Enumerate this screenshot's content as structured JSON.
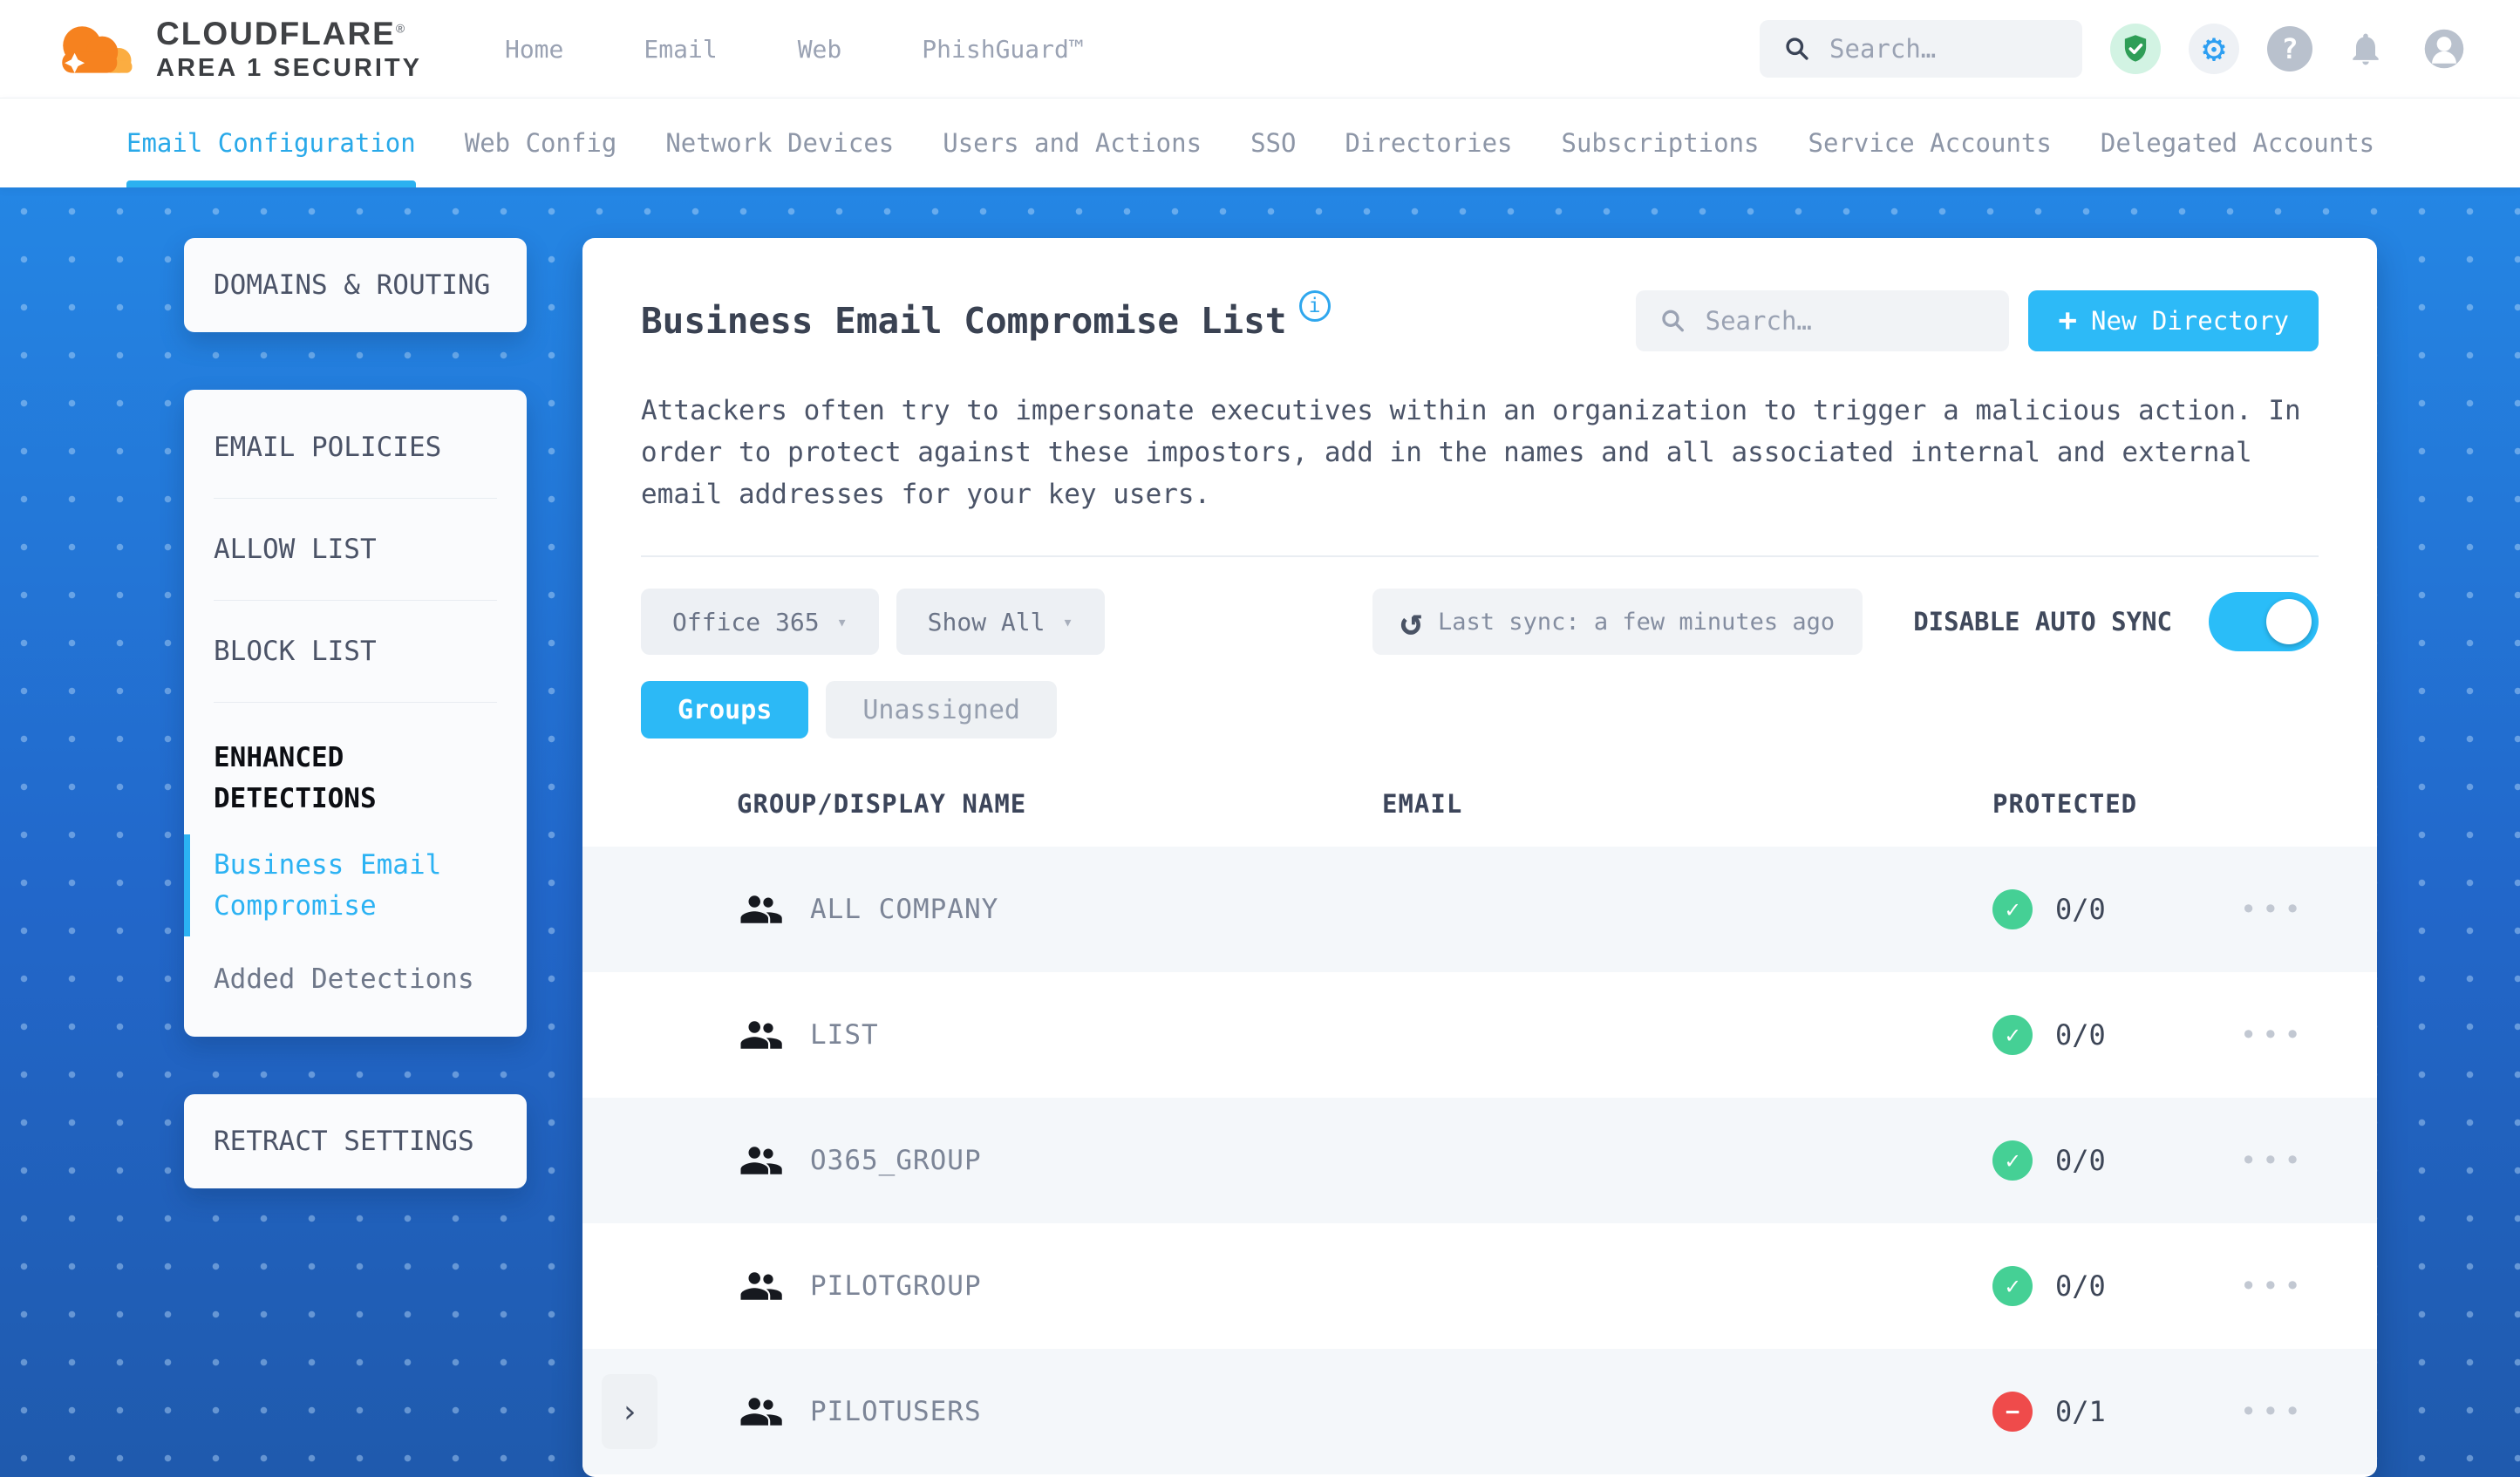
{
  "header": {
    "brand_line1": "CLOUDFLARE",
    "brand_registered": "®",
    "brand_line2": "AREA 1 SECURITY",
    "nav": [
      "Home",
      "Email",
      "Web",
      "PhishGuard™"
    ],
    "search_placeholder": "Search…"
  },
  "tabs_bar": {
    "items": [
      {
        "label": "Email Configuration",
        "active": true
      },
      {
        "label": "Web Config",
        "active": false
      },
      {
        "label": "Network Devices",
        "active": false
      },
      {
        "label": "Users and Actions",
        "active": false
      },
      {
        "label": "SSO",
        "active": false
      },
      {
        "label": "Directories",
        "active": false
      },
      {
        "label": "Subscriptions",
        "active": false
      },
      {
        "label": "Service Accounts",
        "active": false
      },
      {
        "label": "Delegated Accounts",
        "active": false
      }
    ]
  },
  "sidebar": {
    "domains_routing": "DOMAINS & ROUTING",
    "email_policies": "EMAIL POLICIES",
    "allow_list": "ALLOW LIST",
    "block_list": "BLOCK LIST",
    "enhanced_detections": "ENHANCED DETECTIONS",
    "business_email_compromise": "Business Email Compromise",
    "added_detections": "Added Detections",
    "retract_settings": "RETRACT SETTINGS"
  },
  "main": {
    "title": "Business Email Compromise List",
    "info_glyph": "i",
    "search_placeholder": "Search…",
    "new_directory": {
      "icon": "+",
      "label": "New Directory"
    },
    "description": "Attackers often try to impersonate executives within an organization to trigger a malicious action. In order to protect against these impostors, add in the names and all associated internal and external email addresses for your key users.",
    "filters": {
      "directory_select": "Office 365",
      "show_select": "Show All"
    },
    "last_sync": "Last sync: a few minutes ago",
    "auto_sync_label": "DISABLE AUTO SYNC",
    "auto_sync_enabled": true,
    "view_tabs": {
      "groups": "Groups",
      "unassigned": "Unassigned"
    },
    "table": {
      "columns": {
        "name": "GROUP/DISPLAY NAME",
        "email": "EMAIL",
        "protected": "PROTECTED"
      },
      "rows": [
        {
          "name": "ALL COMPANY",
          "email": "",
          "protected": "0/0",
          "status": "ok",
          "expandable": false
        },
        {
          "name": "LIST",
          "email": "",
          "protected": "0/0",
          "status": "ok",
          "expandable": false
        },
        {
          "name": "O365_GROUP",
          "email": "",
          "protected": "0/0",
          "status": "ok",
          "expandable": false
        },
        {
          "name": "PILOTGROUP",
          "email": "",
          "protected": "0/0",
          "status": "ok",
          "expandable": false
        },
        {
          "name": "PILOTUSERS",
          "email": "",
          "protected": "0/1",
          "status": "blocked",
          "expandable": true
        }
      ]
    }
  },
  "icons": {
    "caret": "▾",
    "chevron": "›",
    "check": "✓",
    "minus": "−",
    "refresh": "↺",
    "menu": "•••",
    "question": "?",
    "gear": "⚙"
  },
  "colors": {
    "accent_cyan": "#2dbaf7",
    "nav_active_cyan": "#29a9e9",
    "badge_green": "#45d095",
    "badge_red": "#ef4b4b",
    "background_blue": "#2277dc"
  }
}
